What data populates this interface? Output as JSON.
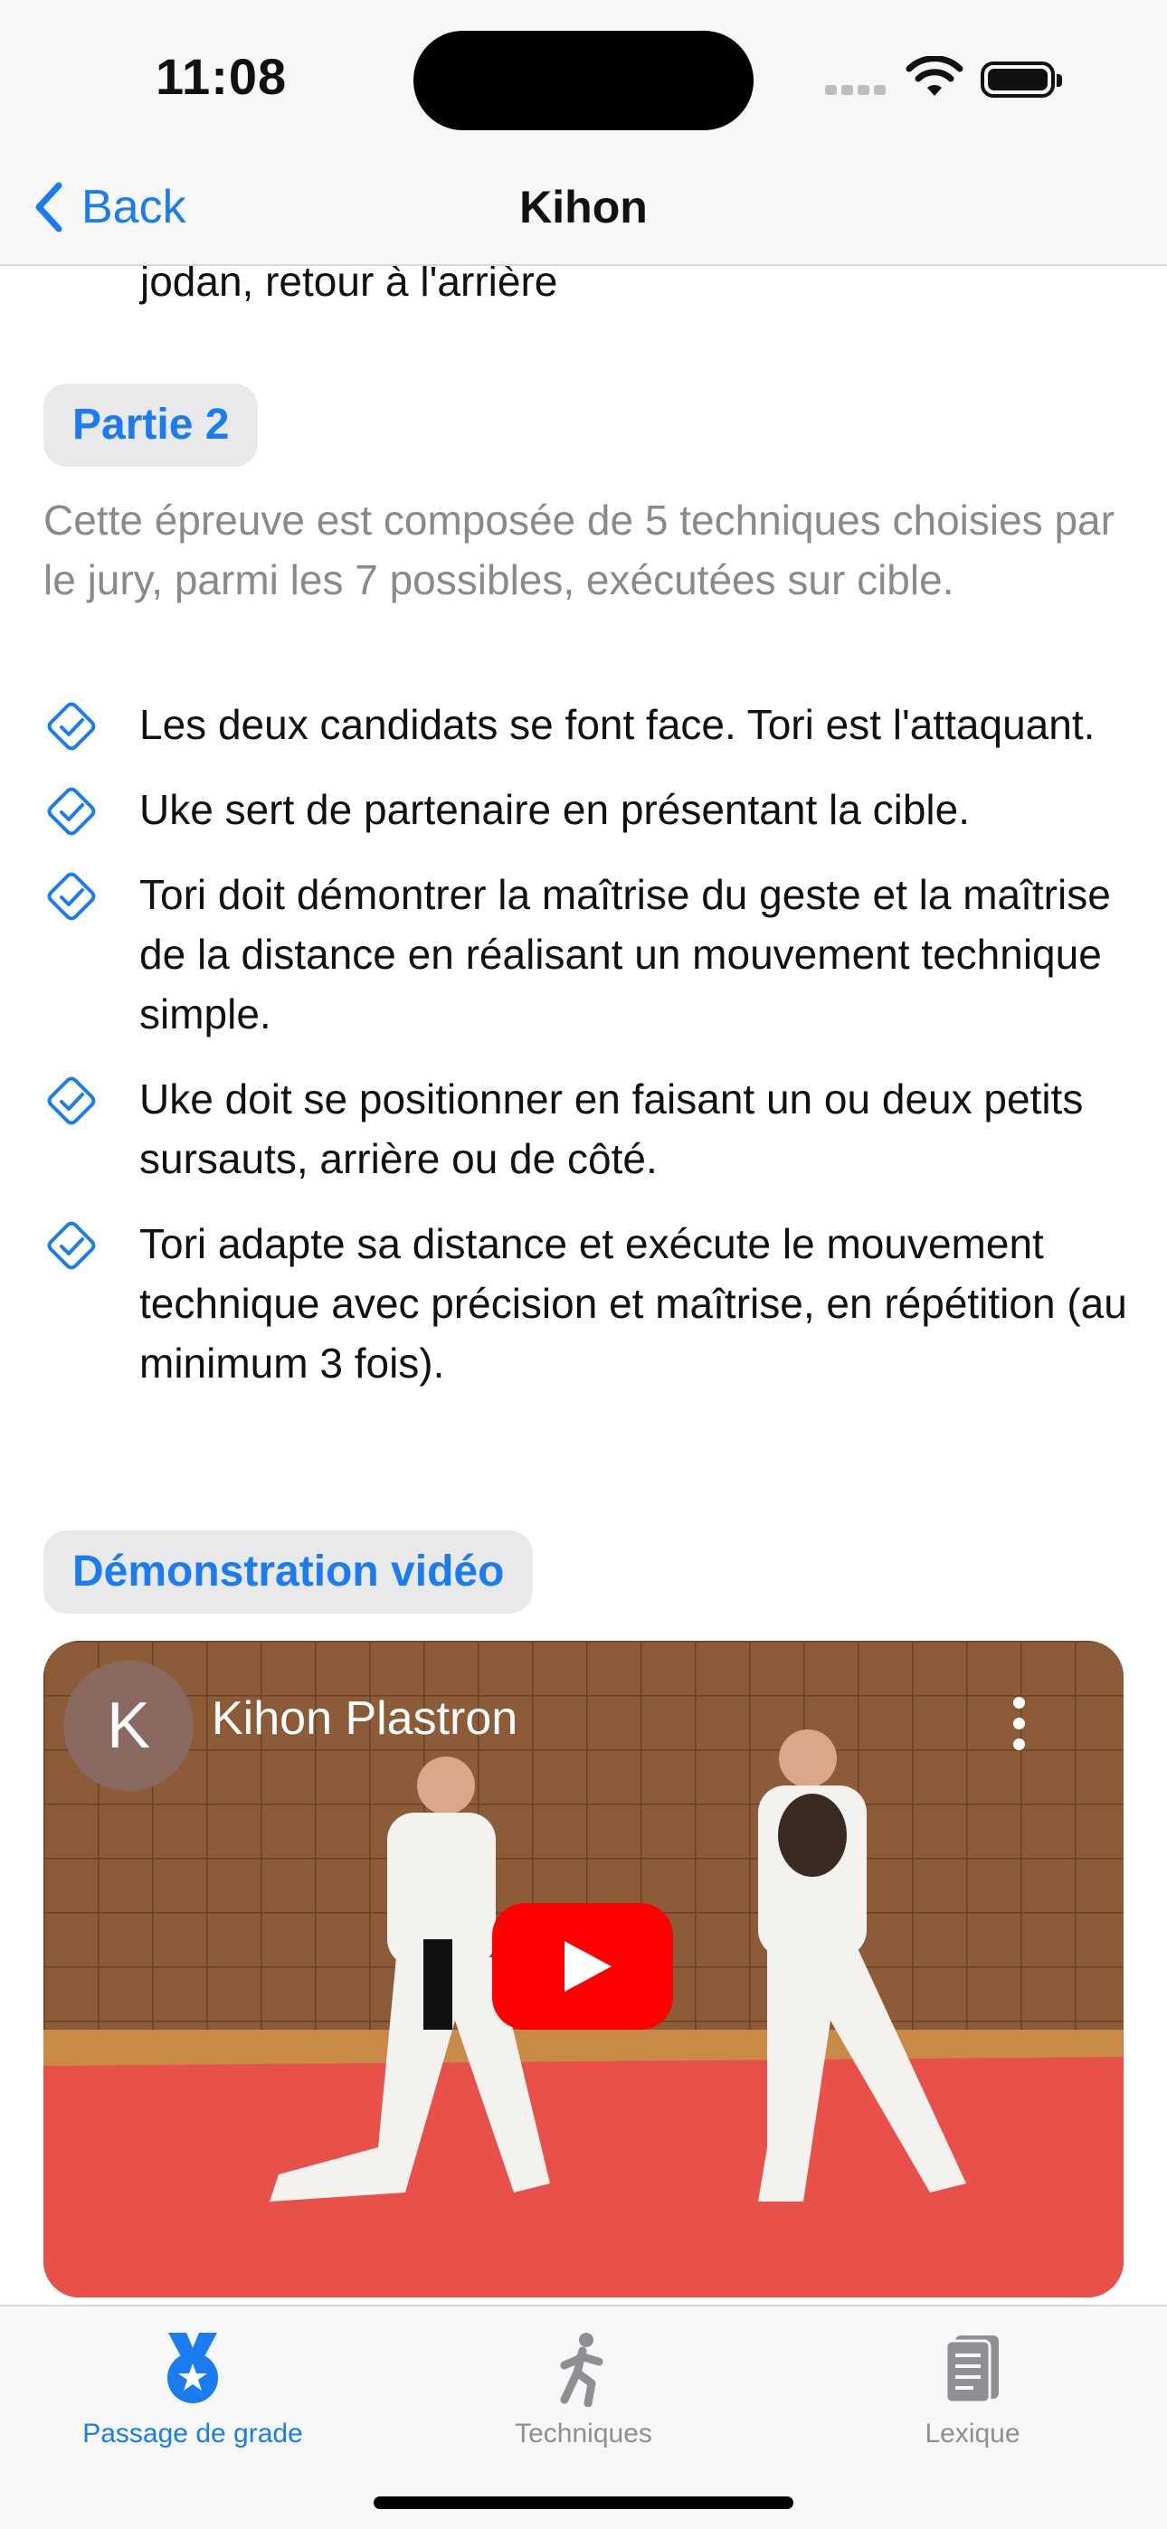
{
  "status": {
    "time": "11:08"
  },
  "nav": {
    "back_label": "Back",
    "title": "Kihon"
  },
  "content": {
    "previous_tail": "jodan, retour à l'arrière",
    "section2": {
      "label": "Partie 2",
      "description": "Cette épreuve est composée de 5 techniques choisies par le jury, parmi les 7 possibles, exécutées sur cible.",
      "items": [
        "Les deux candidats se font face. Tori est l'attaquant.",
        "Uke sert de partenaire en présentant la cible.",
        "Tori doit démontrer la maîtrise du geste et la maîtrise de la distance en réalisant un mouvement technique simple.",
        "Uke doit se positionner en faisant un ou deux petits sursauts, arrière ou de côté.",
        "Tori adapte sa distance et exécute le mouvement technique avec précision et maîtrise, en répétition (au minimum 3 fois)."
      ]
    },
    "video_section": {
      "label": "Démonstration vidéo",
      "video": {
        "channel_initial": "K",
        "title": "Kihon Plastron"
      }
    }
  },
  "tabs": [
    {
      "label": "Passage de grade",
      "icon": "medal-icon",
      "selected": true
    },
    {
      "label": "Techniques",
      "icon": "kick-figure-icon",
      "selected": false
    },
    {
      "label": "Lexique",
      "icon": "book-icon",
      "selected": false
    }
  ],
  "colors": {
    "accent": "#1a7cf0",
    "secondary_text": "#8a8a8e",
    "inactive_tab": "#8e8e93",
    "youtube_red": "#ff0000"
  }
}
